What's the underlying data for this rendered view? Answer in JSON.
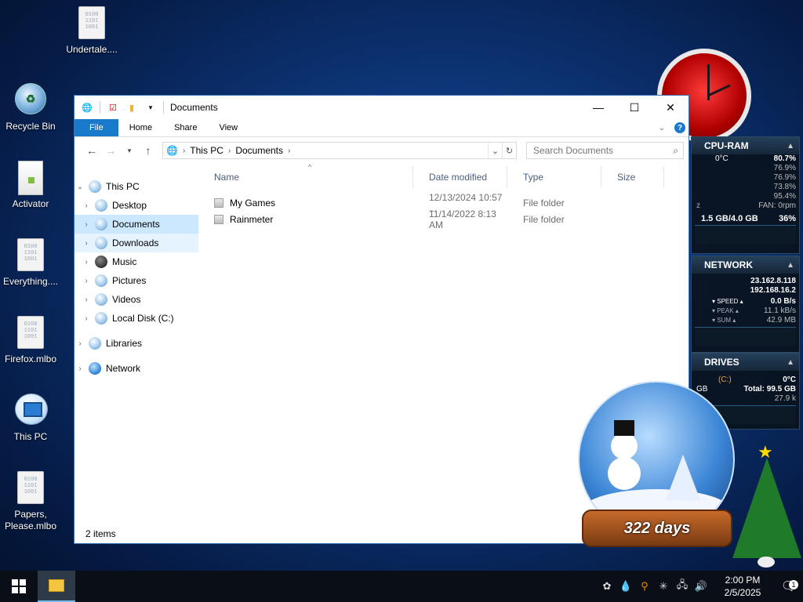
{
  "desktop": {
    "icons": [
      {
        "label": "Undertale....",
        "kind": "file"
      },
      {
        "label": "Recycle Bin",
        "kind": "recycle-bin"
      },
      {
        "label": "Activator",
        "kind": "app"
      },
      {
        "label": "Everything....",
        "kind": "file"
      },
      {
        "label": "Firefox.mlbo",
        "kind": "file"
      },
      {
        "label": "This PC",
        "kind": "this-pc"
      },
      {
        "label": "Papers, Please.mlbo",
        "kind": "file"
      }
    ],
    "binary_glyph": "0100\n1101\n1001"
  },
  "explorer": {
    "title": "Documents",
    "window_buttons": {
      "minimize": "—",
      "maximize": "☐",
      "close": "✕"
    },
    "ribbon_tabs": [
      "File",
      "Home",
      "Share",
      "View"
    ],
    "address": {
      "crumbs": [
        "This PC",
        "Documents"
      ]
    },
    "search": {
      "placeholder": "Search Documents"
    },
    "nav": {
      "this_pc": "This PC",
      "items": [
        "Desktop",
        "Documents",
        "Downloads",
        "Music",
        "Pictures",
        "Videos",
        "Local Disk (C:)"
      ],
      "libraries": "Libraries",
      "network": "Network",
      "selected": "Documents"
    },
    "columns": [
      "Name",
      "Date modified",
      "Type",
      "Size"
    ],
    "files": [
      {
        "name": "My Games",
        "date": "12/13/2024 10:57 ...",
        "type": "File folder",
        "size": ""
      },
      {
        "name": "Rainmeter",
        "date": "11/14/2022 8:13 AM",
        "type": "File folder",
        "size": ""
      }
    ],
    "status": "2 items",
    "accent_color": "#1979ca",
    "selection_color": "#cce8ff"
  },
  "widgets": {
    "cpu_ram": {
      "title": "CPU-RAM",
      "temp": "0°C",
      "cores": [
        "80.7%",
        "76.9%",
        "76.9%",
        "73.8%",
        "95.4%"
      ],
      "fan_label": "z",
      "fan": "FAN: 0rpm",
      "ram": "1.5 GB/4.0 GB",
      "ram_pct": "36%"
    },
    "network": {
      "title": "NETWORK",
      "ip_public": "23.162.8.118",
      "ip_local": "192.168.16.2",
      "speed_label": "SPEED",
      "speed": "0.0 B/s",
      "peak_label": "PEAK",
      "peak": "11.1 kB/s",
      "sum_label": "SUM",
      "sum": "42.9 MB"
    },
    "drives": {
      "title": "DRIVES",
      "gb_label": "GB",
      "drive": "(C:)",
      "temp": "0°C",
      "total": "Total: 99.5 GB",
      "io": "27.9 k"
    }
  },
  "countdown": {
    "label": "322 days"
  },
  "taskbar": {
    "time": "2:00 PM",
    "date": "2/5/2025",
    "notification_count": "1"
  }
}
